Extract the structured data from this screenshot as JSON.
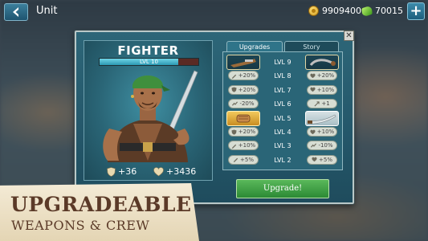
{
  "header": {
    "title": "Unit",
    "back_icon": "chevron-left-icon",
    "coins": "9909400",
    "gems": "70015",
    "add_icon": "plus-icon"
  },
  "hero": {
    "name": "FIGHTER",
    "level": "LVL 10",
    "level_progress": 0.8,
    "armor": "+36",
    "health": "+3436"
  },
  "tabs": [
    "Upgrades",
    "Story"
  ],
  "upgrades": [
    {
      "level": "LVL 9",
      "left": {
        "kind": "weapon",
        "icon": "blunderbuss-icon"
      },
      "right": {
        "kind": "weapon",
        "icon": "chain-weapon-icon"
      }
    },
    {
      "level": "LVL 8",
      "left": {
        "kind": "stat",
        "icon": "sword-icon",
        "value": "+20%"
      },
      "right": {
        "kind": "stat",
        "icon": "heart-icon",
        "value": "+20%"
      }
    },
    {
      "level": "LVL 7",
      "left": {
        "kind": "stat",
        "icon": "shield-icon",
        "value": "+20%"
      },
      "right": {
        "kind": "stat",
        "icon": "heart-icon",
        "value": "+10%"
      }
    },
    {
      "level": "LVL 6",
      "left": {
        "kind": "stat",
        "icon": "speed-icon",
        "value": "-20%"
      },
      "right": {
        "kind": "stat",
        "icon": "range-icon",
        "value": "+1"
      }
    },
    {
      "level": "LVL 5",
      "left": {
        "kind": "weapon",
        "icon": "fist-icon",
        "style": "gold"
      },
      "right": {
        "kind": "weapon",
        "icon": "cutlass-icon",
        "style": "pale"
      }
    },
    {
      "level": "LVL 4",
      "left": {
        "kind": "stat",
        "icon": "shield-icon",
        "value": "+20%"
      },
      "right": {
        "kind": "stat",
        "icon": "heart-icon",
        "value": "+10%"
      }
    },
    {
      "level": "LVL 3",
      "left": {
        "kind": "stat",
        "icon": "sword-icon",
        "value": "+10%"
      },
      "right": {
        "kind": "stat",
        "icon": "speed-icon",
        "value": "-10%"
      }
    },
    {
      "level": "LVL 2",
      "left": {
        "kind": "stat",
        "icon": "sword-icon",
        "value": "+5%"
      },
      "right": {
        "kind": "stat",
        "icon": "heart-icon",
        "value": "+5%"
      }
    }
  ],
  "upgrade_button": "Upgrade!",
  "banner": {
    "line1": "UPGRADEABLE",
    "line2": "WEAPONS & CREW"
  },
  "colors": {
    "panel": "#24576a",
    "button_green": "#3a9a42",
    "banner_text": "#5b3a28",
    "banner_bg": "#efe3c8"
  }
}
